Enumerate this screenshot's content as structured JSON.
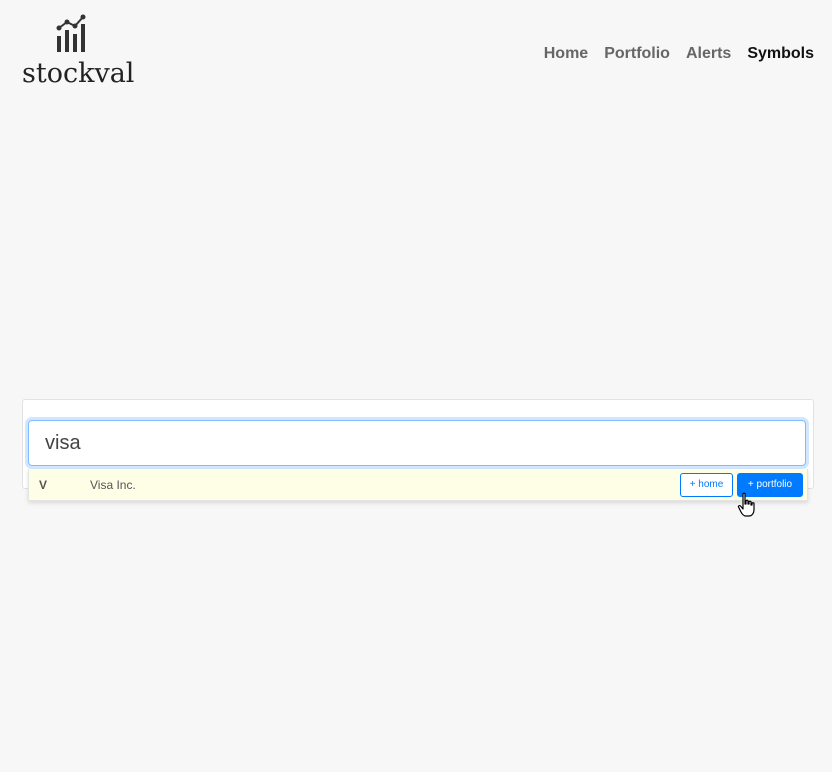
{
  "brand": {
    "name": "stockval",
    "icon": "bar-chart-trend-icon"
  },
  "nav": {
    "items": [
      {
        "label": "Home",
        "active": false
      },
      {
        "label": "Portfolio",
        "active": false
      },
      {
        "label": "Alerts",
        "active": false
      },
      {
        "label": "Symbols",
        "active": true
      }
    ]
  },
  "search": {
    "value": "visa",
    "placeholder": ""
  },
  "results": [
    {
      "symbol": "V",
      "name": "Visa Inc.",
      "add_home_label": "+ home",
      "add_portfolio_label": "+ portfolio"
    }
  ],
  "colors": {
    "accent": "#007bff",
    "background": "#f7f7f7",
    "highlight_row": "#fefde6"
  }
}
